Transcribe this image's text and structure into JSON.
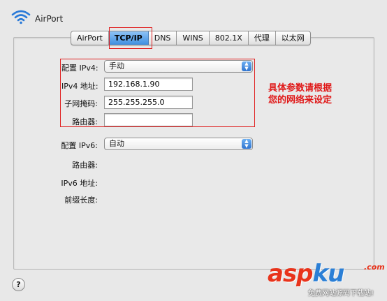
{
  "window": {
    "title": "AirPort"
  },
  "tabs": [
    {
      "label": "AirPort",
      "active": false
    },
    {
      "label": "TCP/IP",
      "active": true
    },
    {
      "label": "DNS",
      "active": false
    },
    {
      "label": "WINS",
      "active": false
    },
    {
      "label": "802.1X",
      "active": false
    },
    {
      "label": "代理",
      "active": false
    },
    {
      "label": "以太网",
      "active": false
    }
  ],
  "ipv4": {
    "configure_label": "配置 IPv4:",
    "configure_value": "手动",
    "address_label": "IPv4 地址:",
    "address_value": "192.168.1.90",
    "subnet_label": "子网掩码:",
    "subnet_value": "255.255.255.0",
    "router_label": "路由器:",
    "router_value": ""
  },
  "ipv6": {
    "configure_label": "配置 IPv6:",
    "configure_value": "自动",
    "router_label": "路由器:",
    "address_label": "IPv6 地址:",
    "prefix_label": "前缀长度:"
  },
  "annotation": {
    "line1": "具体参数请根据",
    "line2": "您的网络来设定",
    "color": "#e02020"
  },
  "help": {
    "label": "?"
  },
  "watermark": {
    "logo_a": "asp",
    "logo_b": "ku",
    "logo_c": ".com",
    "subtitle": "免费网站源码下载站!"
  },
  "icons": {
    "wifi": "wifi-icon",
    "stepper": "popup-stepper-icon",
    "help": "help-icon"
  },
  "colors": {
    "accent": "#3f8fe0",
    "annotation": "#e02020"
  }
}
